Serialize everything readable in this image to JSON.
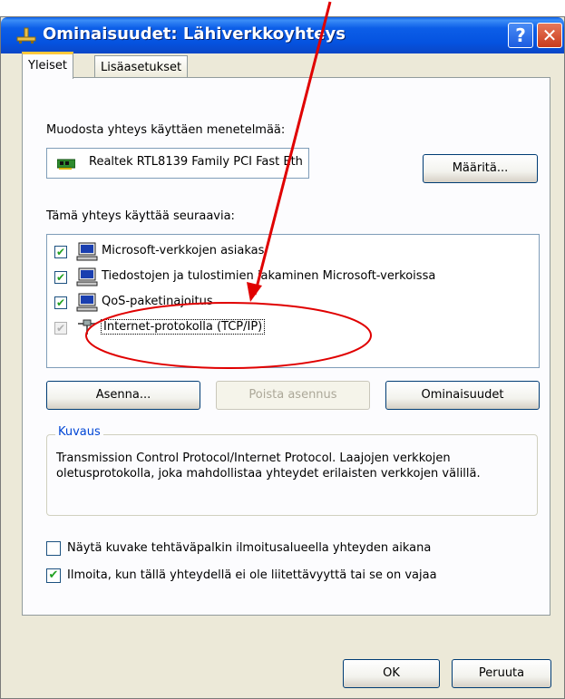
{
  "window": {
    "title": "Ominaisuudet: Lähiverkkoyhteys",
    "help_glyph": "?",
    "close_glyph": "✕"
  },
  "tabs": [
    {
      "label": "Yleiset",
      "active": true
    },
    {
      "label": "Lisäasetukset",
      "active": false
    }
  ],
  "connect_using": {
    "label": "Muodosta yhteys käyttäen menetelmää:",
    "adapter": "Realtek RTL8139 Family PCI Fast Eth",
    "configure_button": "Määritä..."
  },
  "components": {
    "label": "Tämä yhteys käyttää seuraavia:",
    "items": [
      {
        "label": "Microsoft-verkkojen asiakas",
        "checked": true,
        "icon": "network-client-icon"
      },
      {
        "label": "Tiedostojen ja tulostimien jakaminen Microsoft-verkoissa",
        "checked": true,
        "icon": "file-printer-sharing-icon"
      },
      {
        "label": "QoS-paketinajoitus",
        "checked": true,
        "icon": "qos-scheduler-icon"
      },
      {
        "label": "Internet-protokolla (TCP/IP)",
        "checked": true,
        "icon": "protocol-icon",
        "selected": true
      }
    ]
  },
  "buttons": {
    "install": "Asenna...",
    "uninstall": "Poista asennus",
    "properties": "Ominaisuudet",
    "ok": "OK",
    "cancel": "Peruuta"
  },
  "description": {
    "legend": "Kuvaus",
    "text": "Transmission Control Protocol/Internet Protocol. Laajojen verkkojen oletusprotokolla, joka mahdollistaa yhteydet erilaisten verkkojen välillä."
  },
  "options": [
    {
      "label": "Näytä kuvake tehtäväpalkin ilmoitusalueella yhteyden aikana",
      "checked": false
    },
    {
      "label": "Ilmoita, kun tällä yhteydellä ei ole liitettävyyttä tai se on vajaa",
      "checked": true
    }
  ],
  "colors": {
    "titlebar": "#0553e0",
    "annotation": "#e00000",
    "dialog_bg": "#ece9d8",
    "legend_blue": "#0046d5"
  }
}
